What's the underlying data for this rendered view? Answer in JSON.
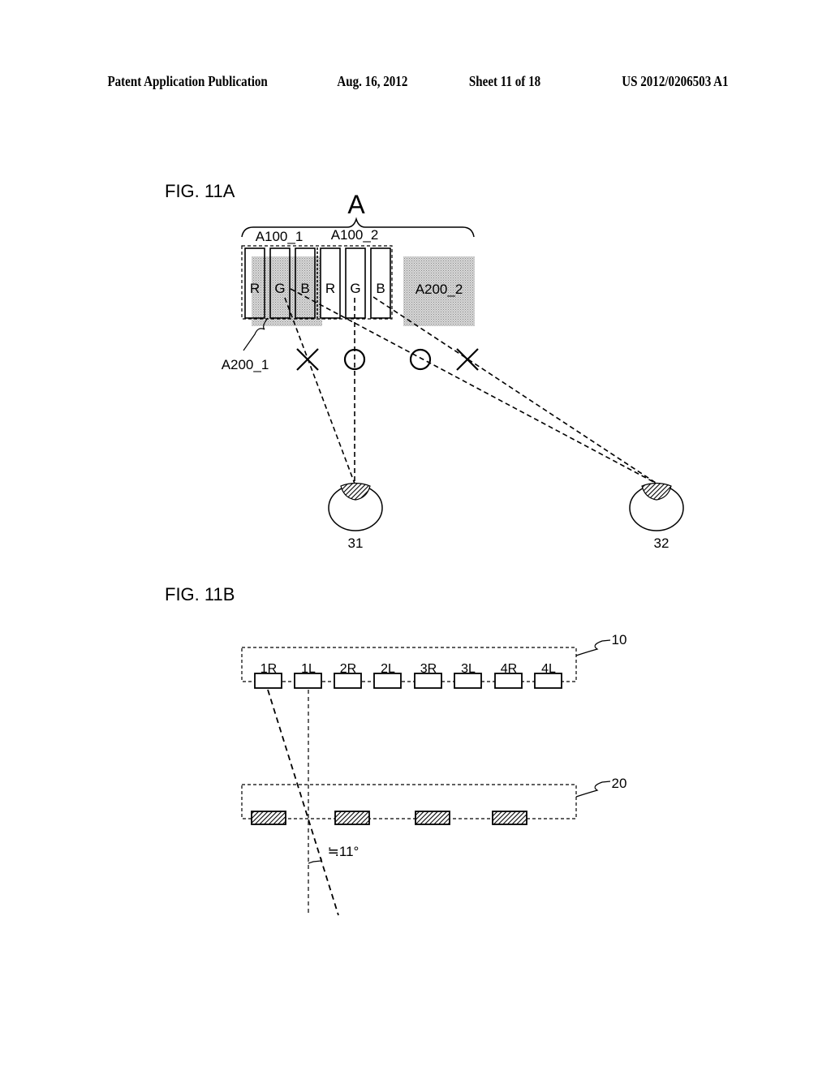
{
  "header": {
    "publication": "Patent Application Publication",
    "date": "Aug. 16, 2012",
    "sheet": "Sheet 11 of 18",
    "number": "US 2012/0206503 A1"
  },
  "fig11a": {
    "title": "FIG. 11A",
    "brace_label": "A",
    "group_labels": [
      "A100_1",
      "A100_2"
    ],
    "subpixels": [
      "R",
      "G",
      "B",
      "R",
      "G",
      "B"
    ],
    "region_labels": {
      "first": "A200_1",
      "second": "A200_2"
    },
    "markers": [
      {
        "symbol": "cross",
        "meaning": "blocked"
      },
      {
        "symbol": "circle",
        "meaning": "visible"
      },
      {
        "symbol": "circle",
        "meaning": "visible"
      },
      {
        "symbol": "cross",
        "meaning": "blocked"
      }
    ],
    "eyes": [
      {
        "ref": "31"
      },
      {
        "ref": "32"
      }
    ]
  },
  "fig11b": {
    "title": "FIG. 11B",
    "layer1_ref": "10",
    "layer2_ref": "20",
    "pixel_labels": [
      "1R",
      "1L",
      "2R",
      "2L",
      "3R",
      "3L",
      "4R",
      "4L"
    ],
    "barrier_count": 4,
    "angle_label": "≒11°"
  }
}
